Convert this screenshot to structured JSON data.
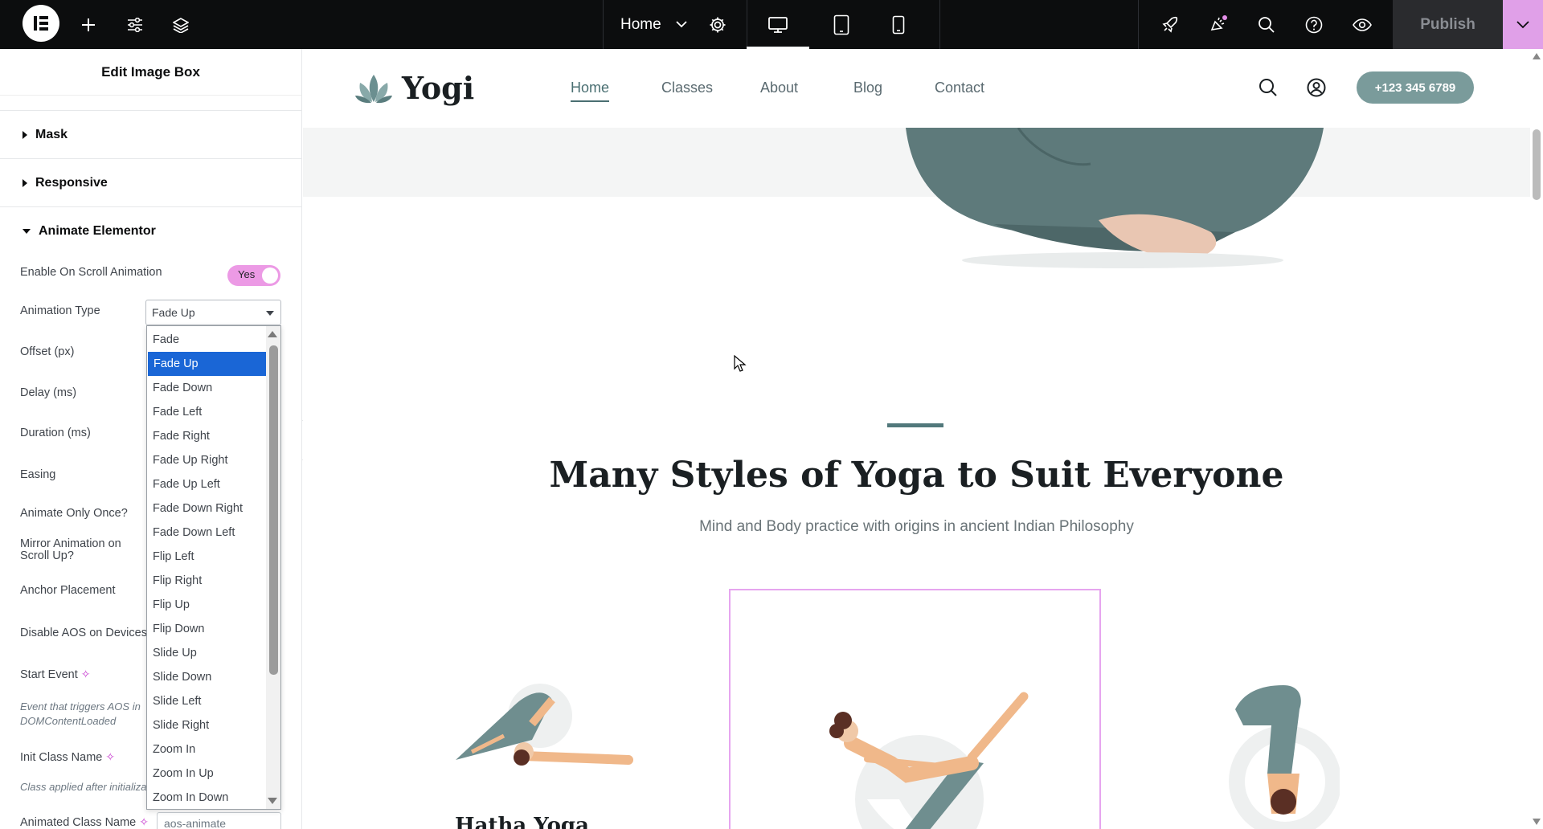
{
  "topbar": {
    "page_name": "Home",
    "publish_label": "Publish",
    "icons": [
      "elementor-logo-icon",
      "add-icon",
      "site-settings-icon",
      "navigator-layers-icon",
      "settings-gear-icon",
      "desktop-icon",
      "tablet-icon",
      "mobile-icon",
      "rocket-icon",
      "notifications-icon",
      "search-icon",
      "help-icon",
      "preview-eye-icon",
      "chevron-down-icon"
    ]
  },
  "panel": {
    "title": "Edit Image Box",
    "sections": {
      "mask": "Mask",
      "responsive": "Responsive",
      "animate": "Animate Elementor"
    },
    "controls": {
      "enable_scroll": "Enable On Scroll Animation",
      "toggle_value": "Yes",
      "animation_type": "Animation Type",
      "animation_type_value": "Fade Up",
      "offset": "Offset (px)",
      "delay": "Delay (ms)",
      "duration": "Duration (ms)",
      "easing": "Easing",
      "animate_once": "Animate Only Once?",
      "mirror": "Mirror Animation on Scroll Up?",
      "anchor": "Anchor Placement",
      "disable_aos": "Disable AOS on Devices",
      "start_event": "Start Event",
      "start_event_desc": "Event that triggers AOS in DOMContentLoaded",
      "init_class": "Init Class Name",
      "init_class_desc": "Class applied after initialization",
      "animated_class": "Animated Class Name",
      "animated_class_value": "aos-animate"
    },
    "dropdown_options": [
      "Fade",
      "Fade Up",
      "Fade Down",
      "Fade Left",
      "Fade Right",
      "Fade Up Right",
      "Fade Up Left",
      "Fade Down Right",
      "Fade Down Left",
      "Flip Left",
      "Flip Right",
      "Flip Up",
      "Flip Down",
      "Slide Up",
      "Slide Down",
      "Slide Left",
      "Slide Right",
      "Zoom In",
      "Zoom In Up",
      "Zoom In Down"
    ],
    "dropdown_selected": "Fade Up"
  },
  "site": {
    "brand": "Yogi",
    "nav": [
      "Home",
      "Classes",
      "About",
      "Blog",
      "Contact"
    ],
    "phone": "+123 345 6789",
    "section_title": "Many Styles of Yoga to Suit Everyone",
    "section_subtitle": "Mind and Body practice with origins in ancient Indian Philosophy",
    "card1_title": "Hatha Yoga"
  },
  "colors": {
    "accent_pink": "#e0a0e8",
    "teal": "#51787b",
    "selection_blue": "#1a66d6"
  }
}
